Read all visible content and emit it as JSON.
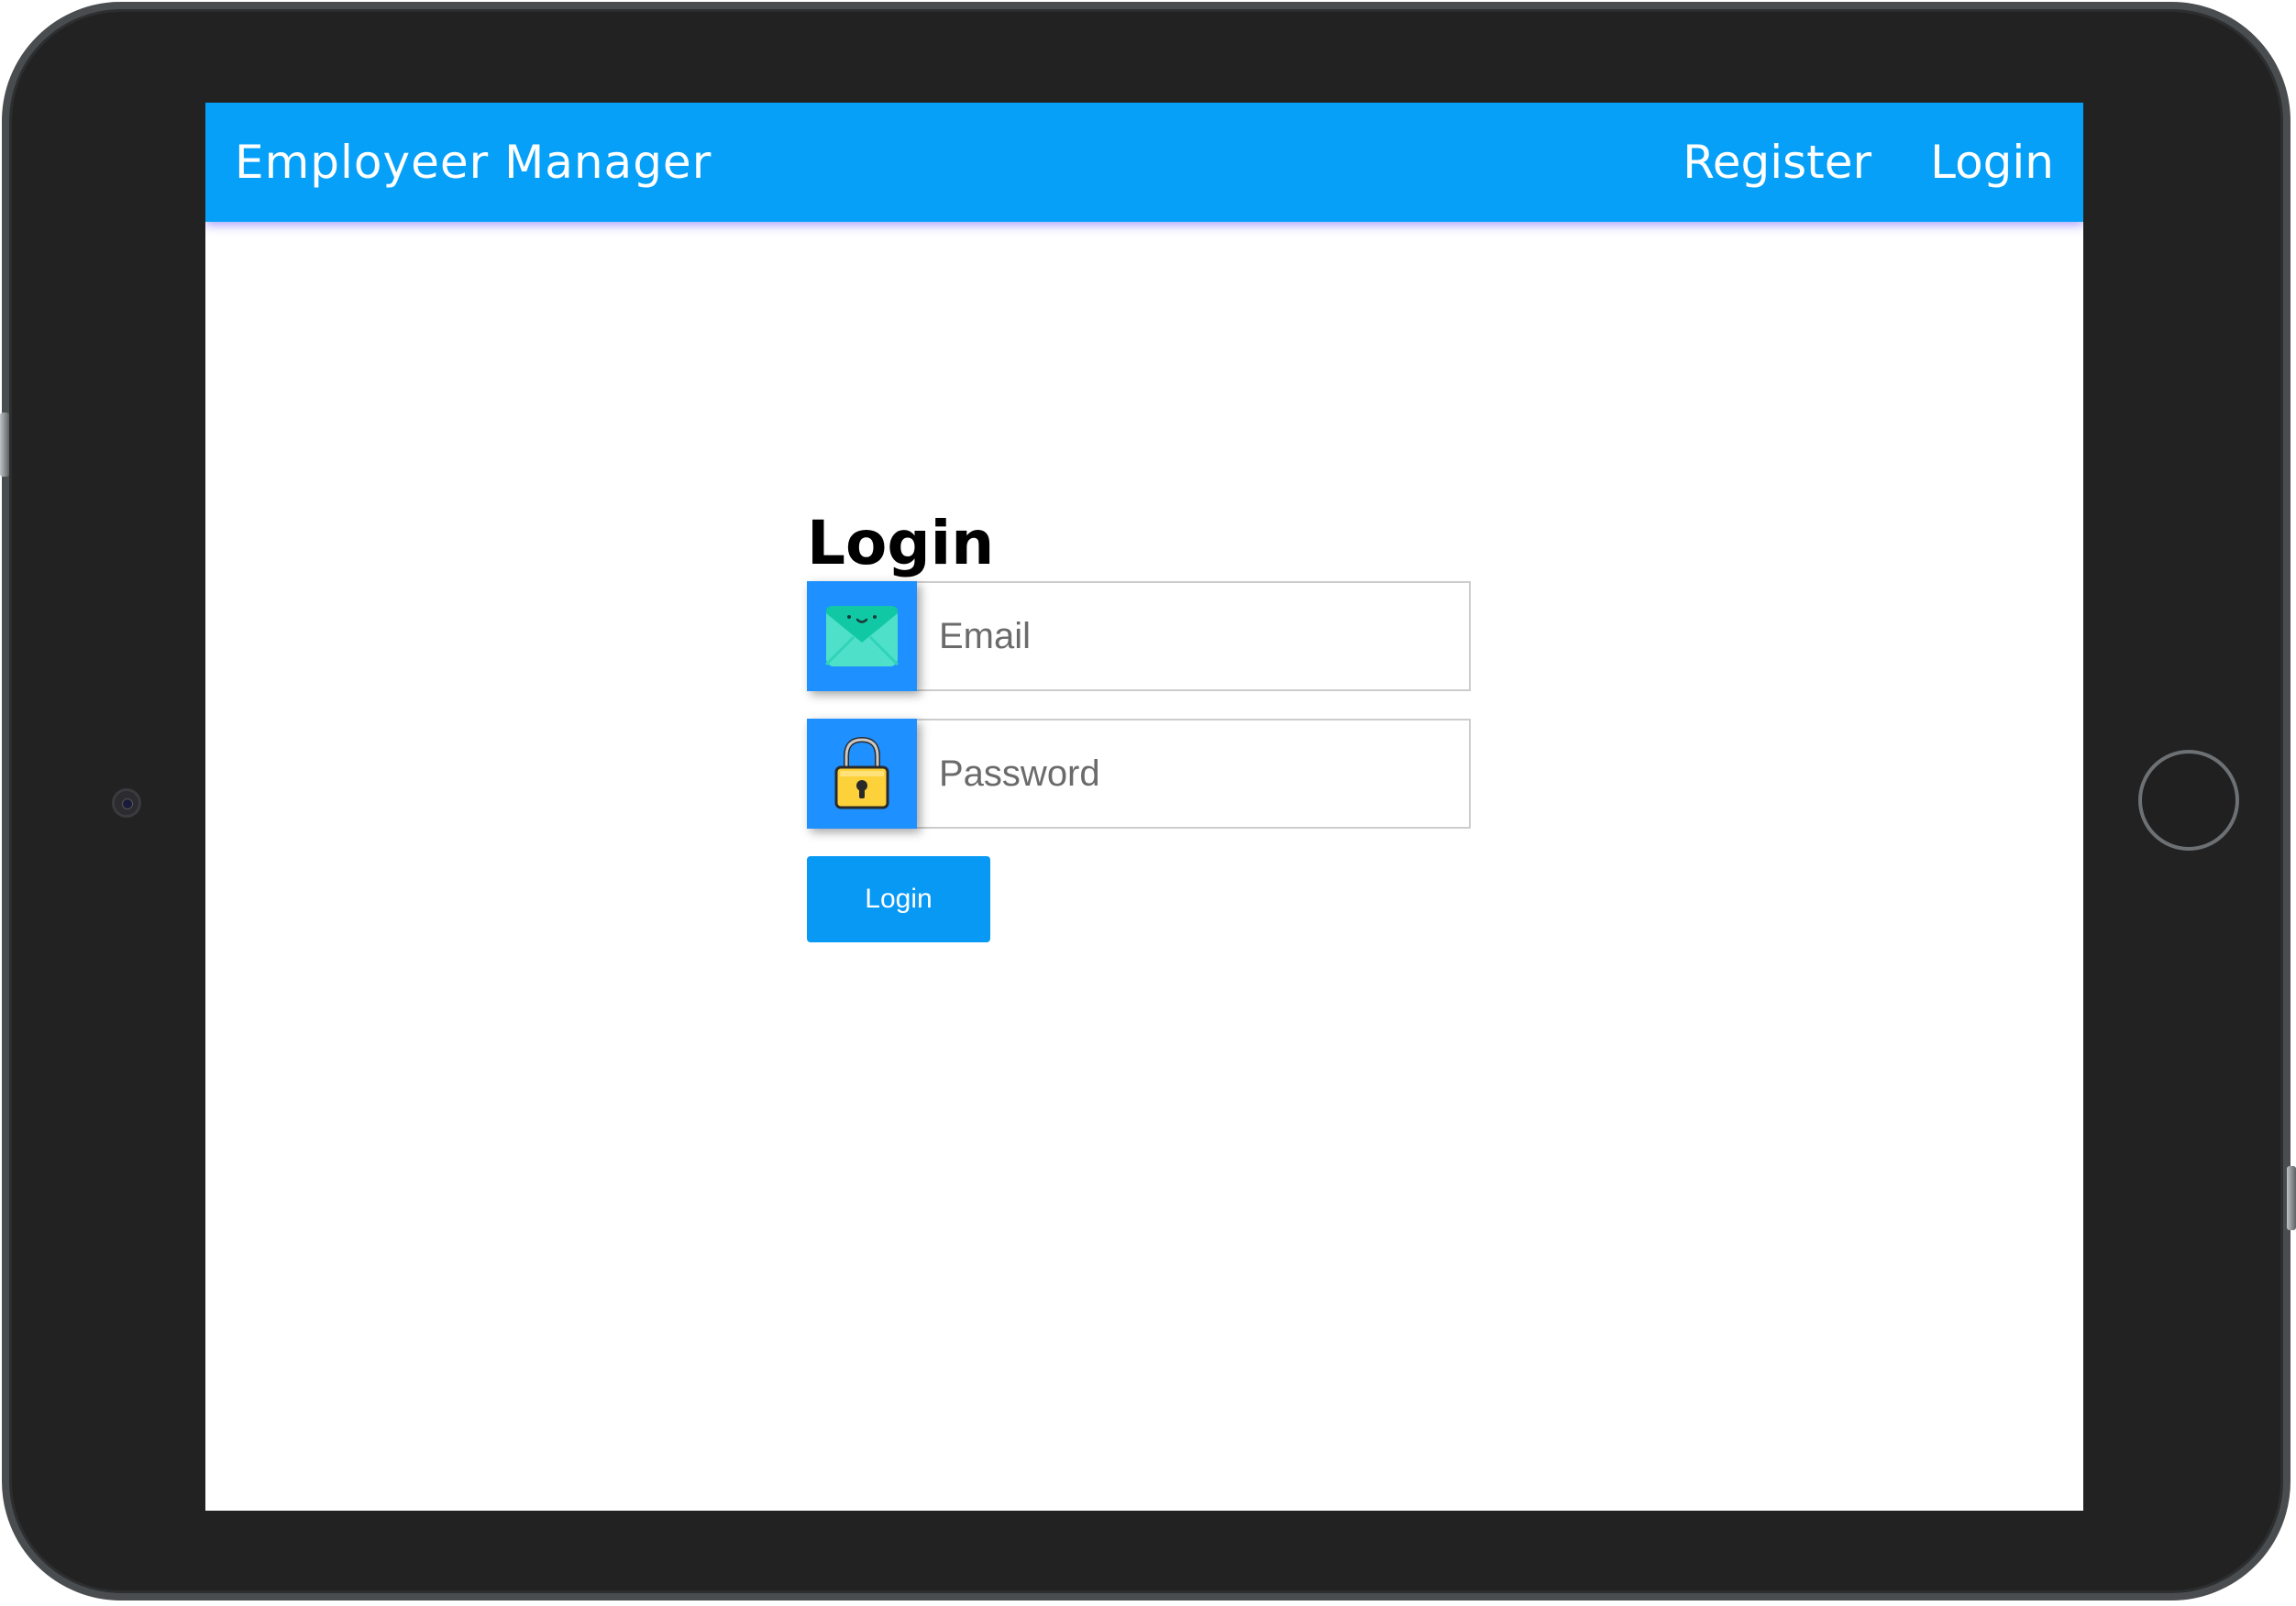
{
  "navbar": {
    "brand": "Employeer Manager",
    "links": [
      {
        "label": "Register"
      },
      {
        "label": "Login"
      }
    ],
    "background_color": "#06a0f8"
  },
  "form": {
    "title": "Login",
    "email": {
      "placeholder": "Email",
      "value": "",
      "icon": "envelope-icon"
    },
    "password": {
      "placeholder": "Password",
      "value": "",
      "icon": "padlock-icon"
    },
    "submit_label": "Login",
    "icon_box_color": "#1e90ff",
    "button_color": "#0899f5"
  }
}
